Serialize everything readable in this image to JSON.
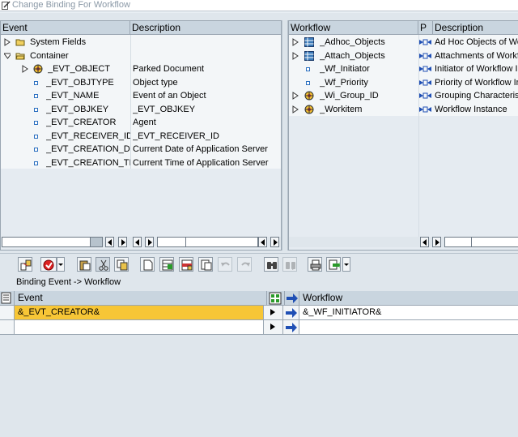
{
  "window": {
    "title": "Change Binding For Workflow"
  },
  "event_panel": {
    "headers": {
      "event": "Event",
      "description": "Description"
    },
    "rows": [
      {
        "name": "System Fields",
        "desc": "",
        "kind": "folder",
        "expander": "collapsed"
      },
      {
        "name": "Container",
        "desc": "",
        "kind": "folder-open",
        "expander": "expanded"
      },
      {
        "name": "_EVT_OBJECT",
        "desc": "Parked Document",
        "kind": "object",
        "expander": "collapsed"
      },
      {
        "name": "_EVT_OBJTYPE",
        "desc": "Object type",
        "kind": "element",
        "expander": "none"
      },
      {
        "name": "_EVT_NAME",
        "desc": "Event of an Object",
        "kind": "element",
        "expander": "none"
      },
      {
        "name": "_EVT_OBJKEY",
        "desc": "_EVT_OBJKEY",
        "kind": "element",
        "expander": "none"
      },
      {
        "name": "_EVT_CREATOR",
        "desc": "Agent",
        "kind": "element",
        "expander": "none"
      },
      {
        "name": "_EVT_RECEIVER_ID",
        "desc": "_EVT_RECEIVER_ID",
        "kind": "element",
        "expander": "none"
      },
      {
        "name": "_EVT_CREATION_D",
        "desc": "Current Date of Application Server",
        "kind": "element",
        "expander": "none"
      },
      {
        "name": "_EVT_CREATION_TI",
        "desc": "Current Time of Application Server",
        "kind": "element",
        "expander": "none"
      }
    ]
  },
  "workflow_panel": {
    "headers": {
      "workflow": "Workflow",
      "p": "P",
      "description": "Description"
    },
    "rows": [
      {
        "name": "_Adhoc_Objects",
        "desc": "Ad Hoc Objects of Wo",
        "kind": "table",
        "expander": "collapsed"
      },
      {
        "name": "_Attach_Objects",
        "desc": "Attachments of Workfl",
        "kind": "table",
        "expander": "collapsed"
      },
      {
        "name": "_Wf_Initiator",
        "desc": "Initiator of Workflow In",
        "kind": "element",
        "expander": "none"
      },
      {
        "name": "_Wf_Priority",
        "desc": "Priority of Workflow In",
        "kind": "element",
        "expander": "none"
      },
      {
        "name": "_Wi_Group_ID",
        "desc": "Grouping Characteris",
        "kind": "object",
        "expander": "collapsed"
      },
      {
        "name": "_Workitem",
        "desc": "Workflow Instance",
        "kind": "object",
        "expander": "collapsed"
      }
    ]
  },
  "binding": {
    "title": "Binding Event -> Workflow",
    "headers": {
      "event": "Event",
      "workflow": "Workflow"
    },
    "rows": [
      {
        "event": "&_EVT_CREATOR&",
        "workflow": "&_WF_INITIATOR&",
        "selected": true
      },
      {
        "event": "",
        "workflow": "",
        "selected": false
      }
    ]
  },
  "colors": {
    "selection": "#f7c636",
    "header": "#c9d5df",
    "arrow": "#1f4fb4"
  }
}
